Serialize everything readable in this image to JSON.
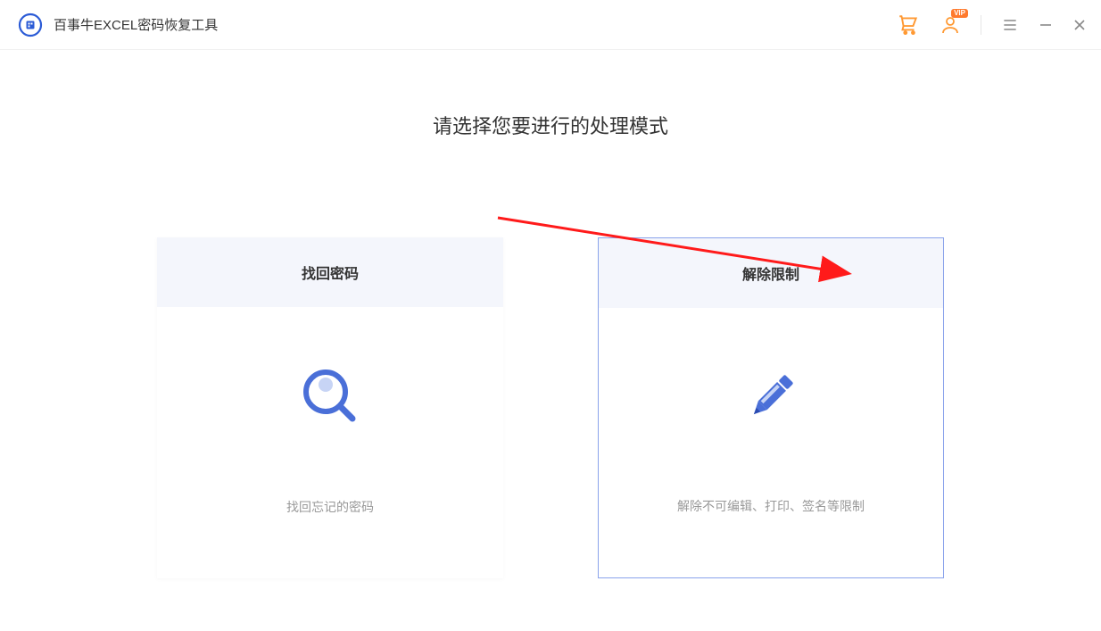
{
  "app": {
    "title": "百事牛EXCEL密码恢复工具"
  },
  "titlebar": {
    "vip_badge": "VIP"
  },
  "main": {
    "heading": "请选择您要进行的处理模式",
    "cards": [
      {
        "title": "找回密码",
        "desc": "找回忘记的密码",
        "icon": "search-magnifier-icon",
        "selected": false
      },
      {
        "title": "解除限制",
        "desc": "解除不可编辑、打印、签名等限制",
        "icon": "pencil-icon",
        "selected": true
      }
    ]
  }
}
